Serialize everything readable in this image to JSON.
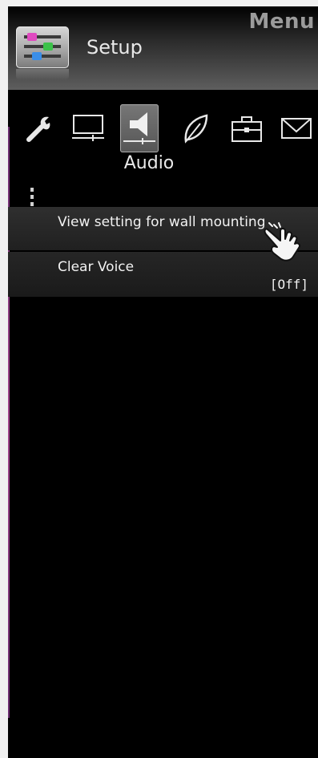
{
  "header": {
    "menu_title": "Menu",
    "section_label": "Setup",
    "section_icon": "sliders-icon"
  },
  "tabs": [
    {
      "icon": "wrench-icon",
      "active": false
    },
    {
      "icon": "monitor-icon",
      "active": false
    },
    {
      "icon": "speaker-icon",
      "active": true,
      "caption": "Audio"
    },
    {
      "icon": "leaf-icon",
      "active": false
    },
    {
      "icon": "briefcase-icon",
      "active": false
    },
    {
      "icon": "envelope-icon",
      "active": false
    }
  ],
  "active_tab_caption": "Audio",
  "menu_items": [
    {
      "label": "View setting for wall mounting",
      "value": ""
    },
    {
      "label": "Clear Voice",
      "value": "[Off]"
    }
  ],
  "cursor": {
    "icon": "hand-pointer-icon"
  },
  "colors": {
    "background": "#000000",
    "highlight_row": "#2a2a2a",
    "text": "#f2f2f2",
    "accent_magenta": "#a0448a"
  }
}
